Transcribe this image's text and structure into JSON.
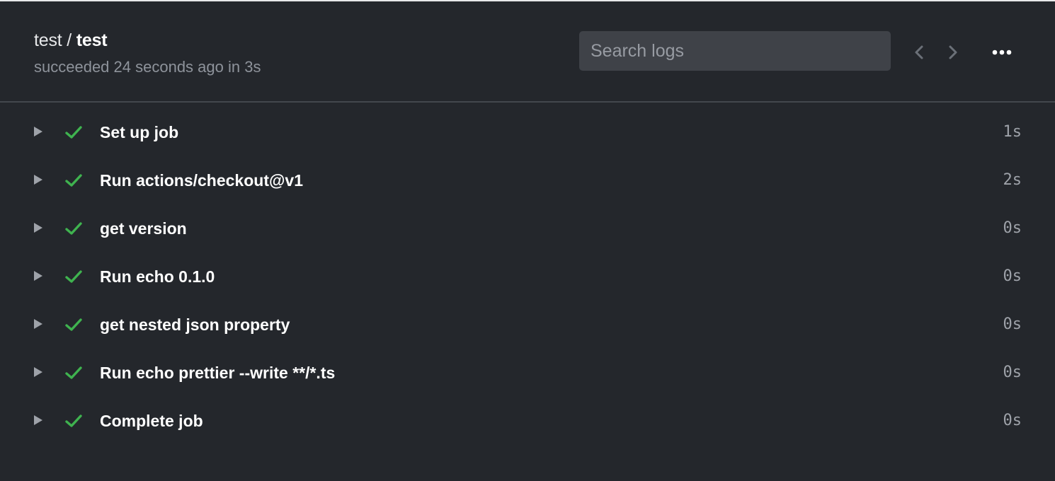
{
  "header": {
    "workflow": "test",
    "separator": " / ",
    "job": "test",
    "status": "succeeded 24 seconds ago in 3s"
  },
  "search": {
    "placeholder": "Search logs",
    "value": ""
  },
  "controls": {
    "prev_icon": "chevron-left-icon",
    "next_icon": "chevron-right-icon",
    "more_icon": "kebab-horizontal-icon"
  },
  "colors": {
    "background": "#24272c",
    "success": "#3fb34f",
    "divider": "#43474d"
  },
  "steps": [
    {
      "name": "Set up job",
      "duration": "1s",
      "status": "success"
    },
    {
      "name": "Run actions/checkout@v1",
      "duration": "2s",
      "status": "success"
    },
    {
      "name": "get version",
      "duration": "0s",
      "status": "success"
    },
    {
      "name": "Run echo 0.1.0",
      "duration": "0s",
      "status": "success"
    },
    {
      "name": "get nested json property",
      "duration": "0s",
      "status": "success"
    },
    {
      "name": "Run echo prettier --write **/*.ts",
      "duration": "0s",
      "status": "success"
    },
    {
      "name": "Complete job",
      "duration": "0s",
      "status": "success"
    }
  ]
}
